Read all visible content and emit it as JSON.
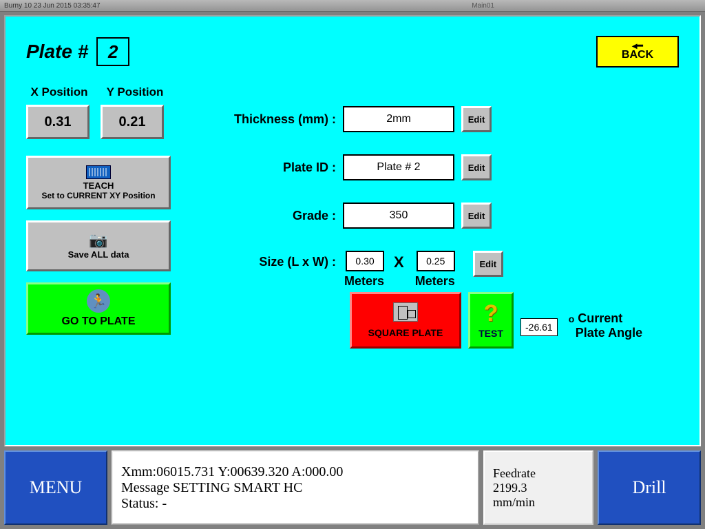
{
  "titlebar": {
    "left": "Burny 10    23 Jun 2015  03:35:47",
    "right": "Main01"
  },
  "header": {
    "label": "Plate #",
    "plate_number": "2"
  },
  "back": {
    "label": "BACK"
  },
  "xy": {
    "x_label": "X Position",
    "y_label": "Y Position",
    "x_val": "0.31",
    "y_val": "0.21"
  },
  "left_buttons": {
    "teach_l1": "TEACH",
    "teach_l2": "Set to CURRENT XY Position",
    "save": "Save ALL data",
    "goto": "GO TO PLATE"
  },
  "form": {
    "thickness_label": "Thickness (mm) :",
    "thickness_val": "2mm",
    "plateid_label": "Plate ID :",
    "plateid_val": "Plate # 2",
    "grade_label": "Grade :",
    "grade_val": "350",
    "size_label": "Size (L x W) :",
    "size_l": "0.30",
    "size_w": "0.25",
    "meters": "Meters",
    "x": "X",
    "edit": "Edit"
  },
  "actions": {
    "square": "SQUARE PLATE",
    "test": "TEST",
    "angle_val": "-26.61",
    "angle_deg": "o",
    "angle_l1": "Current",
    "angle_l2": "Plate Angle"
  },
  "bottom": {
    "menu": "MENU",
    "drill": "Drill",
    "status_l1": "Xmm:06015.731 Y:00639.320 A:000.00",
    "status_l2": "Message SETTING SMART HC",
    "status_l3": "Status:  -",
    "feed_l1": "Feedrate",
    "feed_l2": "2199.3",
    "feed_l3": "mm/min"
  }
}
